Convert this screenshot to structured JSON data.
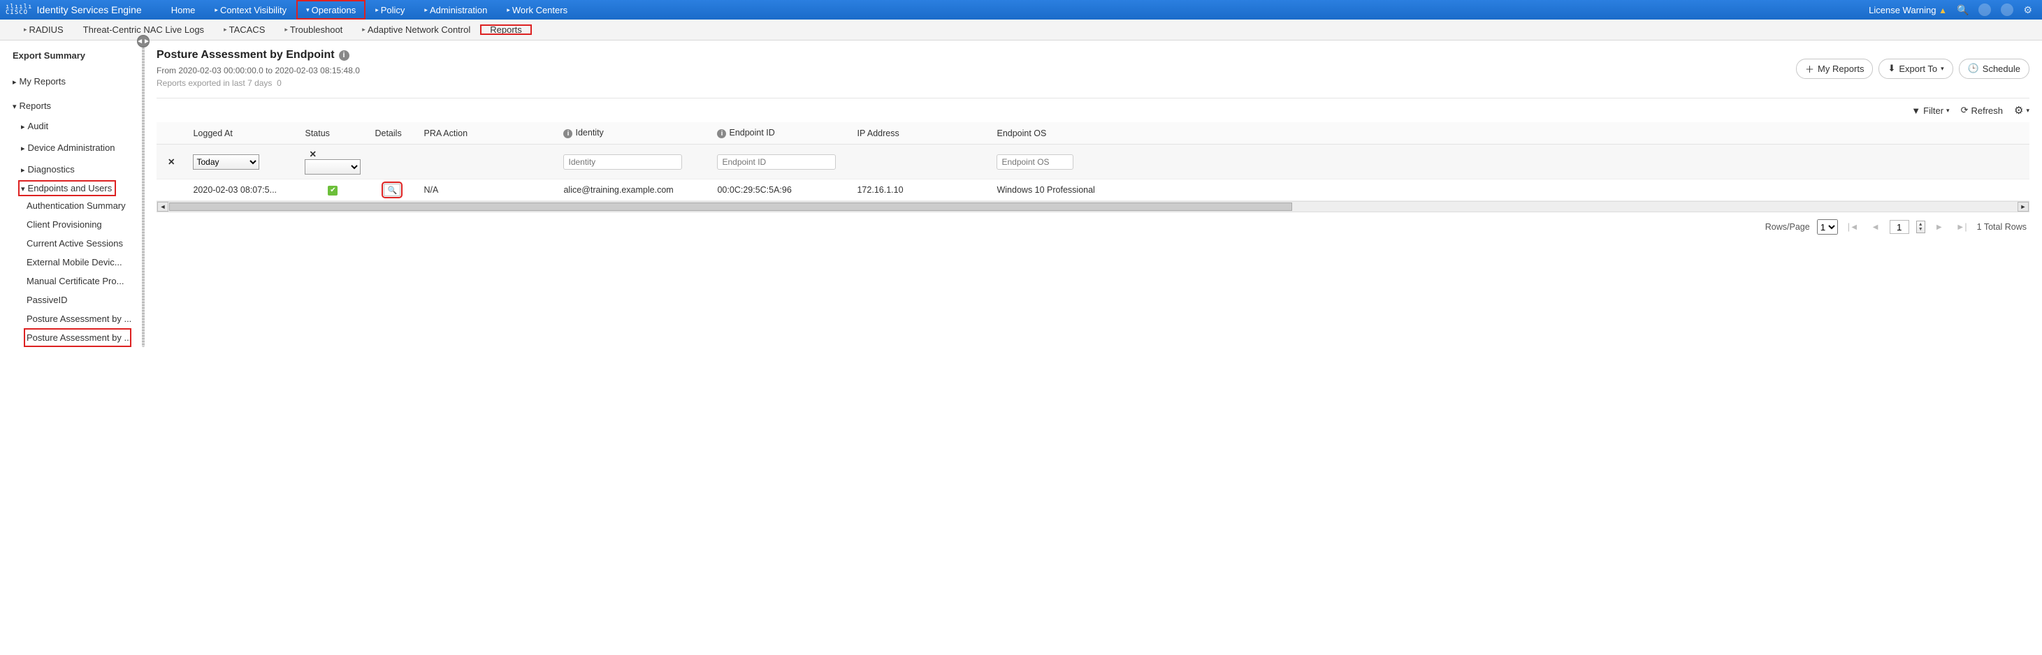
{
  "header": {
    "brand": "cisco",
    "app_title": "Identity Services Engine",
    "license_warning": "License Warning"
  },
  "topnav": {
    "items": [
      {
        "label": "Home",
        "caret": false
      },
      {
        "label": "Context Visibility",
        "caret": true
      },
      {
        "label": "Operations",
        "caret": true,
        "highlight": true
      },
      {
        "label": "Policy",
        "caret": true
      },
      {
        "label": "Administration",
        "caret": true
      },
      {
        "label": "Work Centers",
        "caret": true
      }
    ]
  },
  "subnav": {
    "items": [
      {
        "label": "RADIUS",
        "caret": true
      },
      {
        "label": "Threat-Centric NAC Live Logs",
        "caret": false
      },
      {
        "label": "TACACS",
        "caret": true
      },
      {
        "label": "Troubleshoot",
        "caret": true
      },
      {
        "label": "Adaptive Network Control",
        "caret": true
      },
      {
        "label": "Reports",
        "caret": false,
        "highlight": true
      }
    ]
  },
  "sidebar": {
    "title": "Export Summary",
    "my_reports": "My Reports",
    "reports": "Reports",
    "audit": "Audit",
    "device_admin": "Device Administration",
    "diagnostics": "Diagnostics",
    "endpoints_users": "Endpoints and Users",
    "subs": [
      "Authentication Summary",
      "Client Provisioning",
      "Current Active Sessions",
      "External Mobile Devic...",
      "Manual Certificate Pro...",
      "PassiveID",
      "Posture Assessment by ...",
      "Posture Assessment by ..."
    ]
  },
  "report": {
    "title": "Posture Assessment by Endpoint",
    "range": "From 2020-02-03 00:00:00.0 to 2020-02-03 08:15:48.0",
    "exported_label": "Reports exported in last 7 days",
    "exported_count": "0",
    "buttons": {
      "myreports": "My Reports",
      "exportto": "Export To",
      "schedule": "Schedule"
    },
    "toolbar": {
      "filter": "Filter",
      "refresh": "Refresh"
    },
    "columns": {
      "logged_at": "Logged At",
      "status": "Status",
      "details": "Details",
      "pra": "PRA Action",
      "identity": "Identity",
      "endpoint_id": "Endpoint ID",
      "ip": "IP Address",
      "os": "Endpoint OS"
    },
    "filters": {
      "today": "Today",
      "identity_ph": "Identity",
      "endpoint_id_ph": "Endpoint ID",
      "os_ph": "Endpoint OS"
    },
    "rows": [
      {
        "logged_at": "2020-02-03 08:07:5...",
        "pra": "N/A",
        "identity": "alice@training.example.com",
        "endpoint_id": "00:0C:29:5C:5A:96",
        "ip": "172.16.1.10",
        "os": "Windows 10 Professional"
      }
    ],
    "pager": {
      "rows_page_label": "Rows/Page",
      "rows_page_value": "1",
      "page_value": "1",
      "total": "1 Total Rows"
    }
  }
}
